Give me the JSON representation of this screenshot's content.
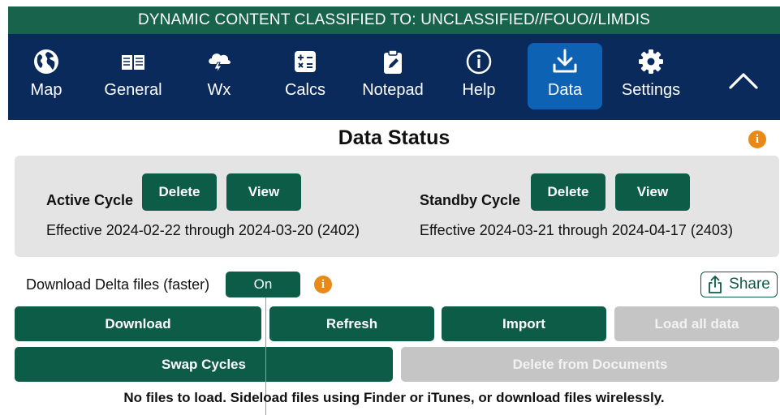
{
  "banner": {
    "text": "DYNAMIC CONTENT CLASSIFIED TO: UNCLASSIFIED//FOUO//LIMDIS"
  },
  "nav": {
    "items": [
      {
        "label": "Map",
        "icon": "globe-icon"
      },
      {
        "label": "General",
        "icon": "book-icon"
      },
      {
        "label": "Wx",
        "icon": "storm-cloud-icon"
      },
      {
        "label": "Calcs",
        "icon": "calculator-icon"
      },
      {
        "label": "Notepad",
        "icon": "notepad-icon"
      },
      {
        "label": "Help",
        "icon": "info-icon"
      },
      {
        "label": "Data",
        "icon": "download-icon",
        "active": true
      },
      {
        "label": "Settings",
        "icon": "gear-icon"
      }
    ],
    "collapse_icon": "chevron-up-icon"
  },
  "page": {
    "title": "Data Status"
  },
  "active_cycle": {
    "label": "Active Cycle",
    "delete_label": "Delete",
    "view_label": "View",
    "effective": "Effective 2024-02-22 through 2024-03-20 (2402)"
  },
  "standby_cycle": {
    "label": "Standby Cycle",
    "delete_label": "Delete",
    "view_label": "View",
    "effective": "Effective 2024-03-21 through 2024-04-17 (2403)"
  },
  "delta": {
    "label": "Download Delta files (faster)",
    "toggle_value": "On"
  },
  "share": {
    "label": "Share"
  },
  "actions": {
    "download": "Download",
    "refresh": "Refresh",
    "import": "Import",
    "load_all": "Load all data",
    "swap_cycles": "Swap Cycles",
    "delete_from_documents": "Delete from Documents"
  },
  "status": {
    "message": "No files to load. Sideload files using Finder or iTunes, or download files wirelessly."
  },
  "colors": {
    "banner": "#17634b",
    "navbar": "#0a2a5c",
    "nav_active": "#0e62b4",
    "button": "#0d5c47",
    "button_disabled": "#c5c5c5",
    "info": "#e8891a",
    "panel": "#e4e4e4"
  }
}
